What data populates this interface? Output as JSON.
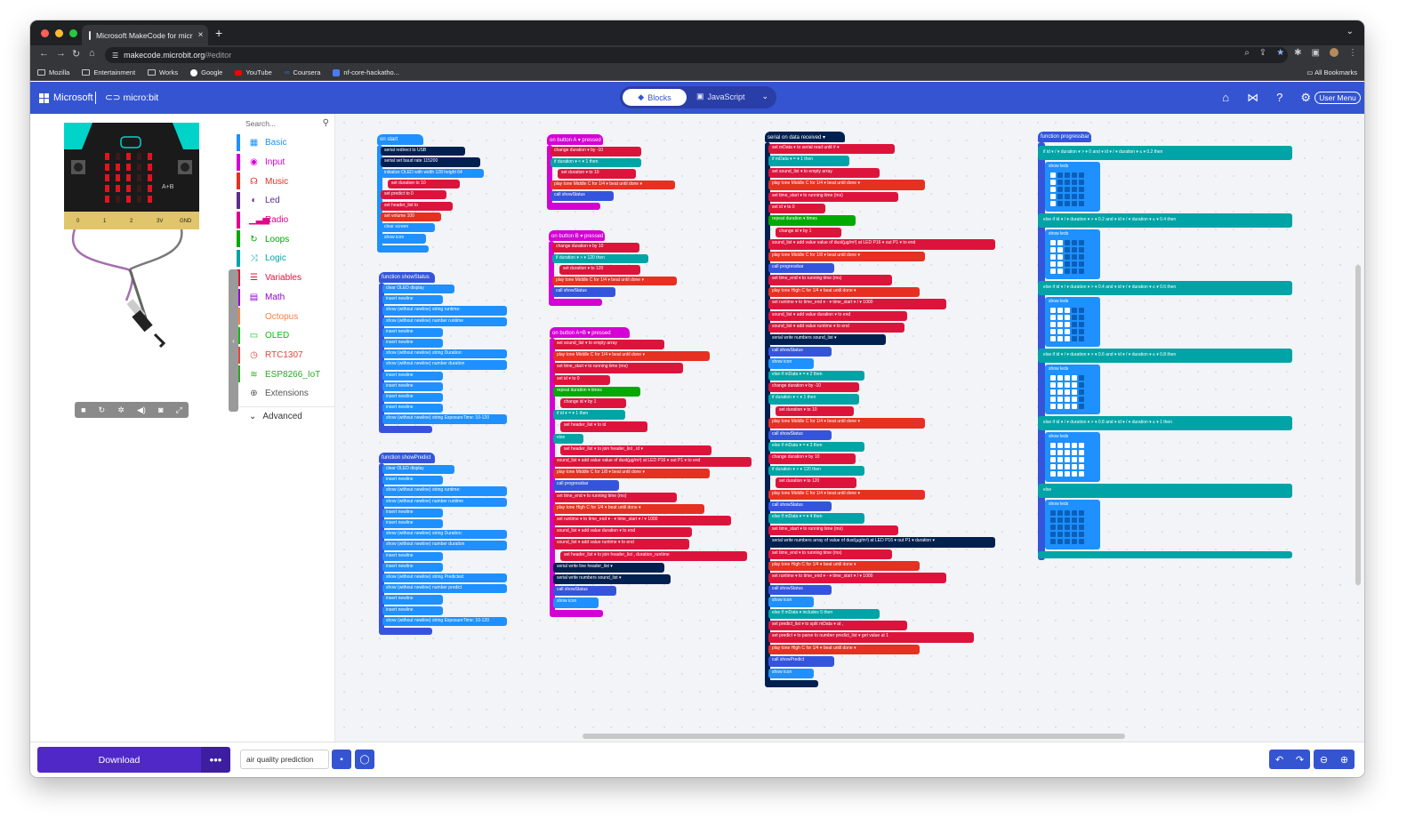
{
  "browser": {
    "tab_title": "Microsoft MakeCode for micr",
    "tab_close": "×",
    "new_tab": "+",
    "url_host": "makecode.microbit.org",
    "url_path": "/#editor",
    "bookmarks": [
      {
        "label": "Mozilla"
      },
      {
        "label": "Entertainment"
      },
      {
        "label": "Works"
      },
      {
        "label": "Google"
      },
      {
        "label": "YouTube"
      },
      {
        "label": "Coursera"
      },
      {
        "label": "nf-core-hackatho..."
      }
    ],
    "all_bookmarks": "All Bookmarks"
  },
  "header": {
    "brand": "Microsoft",
    "product": "micro:bit",
    "mode_blocks": "Blocks",
    "mode_js": "JavaScript",
    "user_menu": "User Menu"
  },
  "toolbox": {
    "search_placeholder": "Search...",
    "categories": [
      {
        "label": "Basic",
        "color": "#1e90ff",
        "icon": "grid-icon"
      },
      {
        "label": "Input",
        "color": "#d400d4",
        "icon": "target-icon"
      },
      {
        "label": "Music",
        "color": "#e63022",
        "icon": "headphones-icon"
      },
      {
        "label": "Led",
        "color": "#5c2d91",
        "icon": "toggle-icon"
      },
      {
        "label": "Radio",
        "color": "#e3008c",
        "icon": "signal-icon"
      },
      {
        "label": "Loops",
        "color": "#00aa00",
        "icon": "loop-icon"
      },
      {
        "label": "Logic",
        "color": "#00a4a6",
        "icon": "shuffle-icon"
      },
      {
        "label": "Variables",
        "color": "#dc143c",
        "icon": "list-icon"
      },
      {
        "label": "Math",
        "color": "#9400d3",
        "icon": "calculator-icon"
      },
      {
        "label": "Octopus",
        "color": "#ff7f3f",
        "icon": "none"
      },
      {
        "label": "OLED",
        "color": "#0fbc11",
        "icon": "monitor-icon"
      },
      {
        "label": "RTC1307",
        "color": "#e6443b",
        "icon": "clock-icon"
      },
      {
        "label": "ESP8266_IoT",
        "color": "#2aa824",
        "icon": "wifi-icon"
      },
      {
        "label": "Extensions",
        "color": "#555555",
        "icon": "plus-circle-icon"
      }
    ],
    "advanced": "Advanced"
  },
  "simulator": {
    "pins": [
      "0",
      "1",
      "2",
      "3V",
      "GND"
    ],
    "label_a": "A",
    "label_b": "B",
    "label_ab": "A+B"
  },
  "workspace": {
    "on_start": {
      "hat": "on start",
      "lines": [
        "serial redirect to USB",
        "serial set baud rate 115200",
        "initialize OLED with width 128 height 64",
        "set duration to 10",
        "set predict to 0",
        "set header_list to",
        "set volume 100",
        "clear screen",
        "show icon"
      ]
    },
    "show_status": {
      "hat": "function showStatus",
      "lines": [
        "clear OLED display",
        "insert newline",
        "show (without newline) string runtime:",
        "show (without newline) number runtime",
        "insert newline",
        "insert newline",
        "show (without newline) string Duration:",
        "show (without newline) number duration",
        "insert newline",
        "insert newline",
        "insert newline",
        "insert newline",
        "show (without newline) string ExposureTime: 10-120"
      ]
    },
    "show_predict": {
      "hat": "function showPredict",
      "lines": [
        "clear OLED display",
        "insert newline",
        "show (without newline) string runtime:",
        "show (without newline) number runtime",
        "insert newline",
        "insert newline",
        "show (without newline) string Duration:",
        "show (without newline) number duration",
        "insert newline",
        "insert newline",
        "show (without newline) string Predicted:",
        "show (without newline) number predict",
        "insert newline",
        "insert newline",
        "show (without newline) string ExposureTime: 10-120"
      ]
    },
    "button_a": {
      "hat": "on button A ▾ pressed",
      "lines": [
        "change duration ▾ by -10",
        "if duration ▾ < ▾ 1 then",
        "set duration ▾ to 10",
        "play tone Middle C for 1/4 ▾ beat until done ▾",
        "call showStatus"
      ]
    },
    "button_b": {
      "hat": "on button B ▾ pressed",
      "lines": [
        "change duration ▾ by 10",
        "if duration ▾ > ▾ 120 then",
        "set duration ▾ to 120",
        "play tone Middle C for 1/4 ▾ beat until done ▾",
        "call showStatus"
      ]
    },
    "button_ab": {
      "hat": "on button A+B ▾ pressed",
      "lines": [
        "set sound_list ▾ to empty array",
        "play tone Middle C for 1/4 ▾ beat until done ▾",
        "set time_start ▾ to running time (ms)",
        "set id ▾ to 0",
        "repeat duration ▾ times",
        "change id ▾ by 1",
        "if id ▾ = ▾ 1 then",
        "set header_list ▾ to id",
        "else",
        "set header_list ▾ to join header_list , id ▾",
        "sound_list ▾ add value value of dust(µg/m³) at LED P16 ▾ out P1 ▾ to end",
        "play tone Middle C for 1/8 ▾ beat until done ▾",
        "call progressbar",
        "set time_end ▾ to running time (ms)",
        "play tone High C for 1/4 ▾ beat until done ▾",
        "set runtime ▾ to time_end ▾ - ▾ time_start ▾ / ▾ 1000",
        "sound_list ▾ add value duration ▾ to end",
        "sound_list ▾ add value runtime ▾ to end",
        "set header_list ▾ to join header_list , duration_runtime",
        "serial write line header_list ▾",
        "serial write numbers sound_list ▾",
        "call showStatus",
        "show icon"
      ]
    },
    "serial": {
      "hat": "serial on data received ▾",
      "lines": [
        "set mData ▾ to serial read until # ▾",
        "if mData ▾ = ▾ 1 then",
        "set sound_list ▾ to empty array",
        "play tone Middle C for 1/4 ▾ beat until done ▾",
        "set time_start ▾ to running time (ms)",
        "set id ▾ to 0",
        "repeat duration ▾ times",
        "change id ▾ by 1",
        "sound_list ▾ add value value of dust(µg/m³) at LED P16 ▾ out P1 ▾ to end",
        "play tone Middle C for 1/8 ▾ beat until done ▾",
        "call progressbar",
        "set time_end ▾ to running time (ms)",
        "play tone High C for 1/4 ▾ beat until done ▾",
        "set runtime ▾ to time_end ▾ - ▾ time_start ▾ / ▾ 1000",
        "sound_list ▾ add value duration ▾ to end",
        "sound_list ▾ add value runtime ▾ to end",
        "serial write numbers sound_list ▾",
        "call showStatus",
        "show icon",
        "else if mData ▾ = ▾ 2 then",
        "change duration ▾ by -10",
        "if duration ▾ < ▾ 1 then",
        "set duration ▾ to 10",
        "play tone Middle C for 1/4 ▾ beat until done ▾",
        "call showStatus",
        "else if mData ▾ = ▾ 3 then",
        "change duration ▾ by 10",
        "if duration ▾ > ▾ 120 then",
        "set duration ▾ to 120",
        "play tone Middle C for 1/4 ▾ beat until done ▾",
        "call showStatus",
        "else if mData ▾ = ▾ 4 then",
        "set time_start ▾ to running time (ms)",
        "serial write numbers array of value of dust(µg/m³) at LED P16 ▾ out P1 ▾ duration ▾",
        "set time_end ▾ to running time (ms)",
        "play tone High C for 1/4 ▾ beat until done ▾",
        "set runtime ▾ to time_end ▾ - ▾ time_start ▾ / ▾ 1000",
        "call showStatus",
        "show icon",
        "else if mData ▾ includes 5 then",
        "set predict_list ▾ to split mData ▾ at ,",
        "set predict ▾ to parse to number predict_list ▾ get value at 1",
        "play tone High C for 1/4 ▾ beat until done ▾",
        "call showPredict",
        "show icon"
      ]
    },
    "progressbar": {
      "hat": "function progressbar",
      "lines": [
        "if id ▾ / ▾ duration ▾ > ▾ 0 and ▾ id ▾ / ▾ duration ▾ ≤ ▾ 0.2 then",
        "show leds",
        "else if id ▾ / ▾ duration ▾ > ▾ 0.2 and ▾ id ▾ / ▾ duration ▾ ≤ ▾ 0.4 then",
        "show leds",
        "else if id ▾ / ▾ duration ▾ > ▾ 0.4 and ▾ id ▾ / ▾ duration ▾ ≤ ▾ 0.6 then",
        "show leds",
        "else if id ▾ / ▾ duration ▾ > ▾ 0.6 and ▾ id ▾ / ▾ duration ▾ ≤ ▾ 0.8 then",
        "show leds",
        "else if id ▾ / ▾ duration ▾ > ▾ 0.8 and ▾ id ▾ / ▾ duration ▾ ≤ ▾ 1 then",
        "show leds",
        "else",
        "show leds"
      ],
      "lit_columns": [
        1,
        2,
        3,
        4,
        5
      ]
    }
  },
  "footer": {
    "download": "Download",
    "more": "•••",
    "project_name": "air quality prediction"
  }
}
